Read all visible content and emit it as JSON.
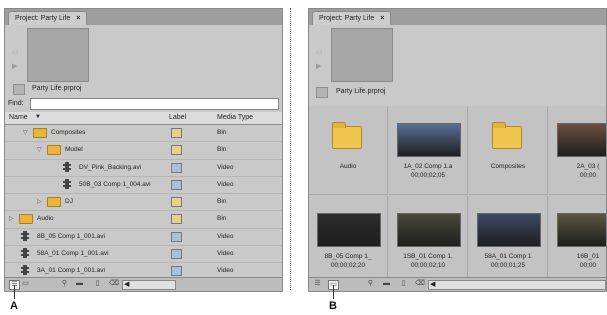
{
  "panelA": {
    "tab_title": "Project: Party Life",
    "tab_close": "×",
    "project_file": "Party Life.prproj",
    "find_label": "Find:",
    "find_value": "",
    "columns": {
      "name": "Name",
      "label": "Label",
      "media_type": "Media Type"
    },
    "rows": [
      {
        "name": "Composites",
        "type": "Bin",
        "kind": "folder",
        "indent": 1,
        "twisty": "open",
        "label_color": "#e8cf8a"
      },
      {
        "name": "Model",
        "type": "Bin",
        "kind": "folder",
        "indent": 2,
        "twisty": "open",
        "label_color": "#e8cf8a"
      },
      {
        "name": "DV_Pink_Backing.avi",
        "type": "Video",
        "kind": "clip",
        "indent": 3,
        "twisty": "",
        "label_color": "#a9c0d6"
      },
      {
        "name": "50B_03 Comp 1_004.avi",
        "type": "Video",
        "kind": "clip",
        "indent": 3,
        "twisty": "",
        "label_color": "#a9c0d6"
      },
      {
        "name": "DJ",
        "type": "Bin",
        "kind": "folder",
        "indent": 2,
        "twisty": "closed",
        "label_color": "#e8cf8a"
      },
      {
        "name": "Audio",
        "type": "Bin",
        "kind": "folder",
        "indent": 0,
        "twisty": "closed",
        "label_color": "#e8cf8a"
      },
      {
        "name": "8B_05 Comp 1_001.avi",
        "type": "Video",
        "kind": "clip",
        "indent": 0,
        "twisty": "",
        "label_color": "#a9c0d6"
      },
      {
        "name": "58A_01 Comp 1_001.avi",
        "type": "Video",
        "kind": "clip",
        "indent": 0,
        "twisty": "",
        "label_color": "#a9c0d6"
      },
      {
        "name": "3A_01 Comp 1_001.avi",
        "type": "Video",
        "kind": "clip",
        "indent": 0,
        "twisty": "",
        "label_color": "#a9c0d6"
      }
    ]
  },
  "panelB": {
    "tab_title": "Project: Party Life",
    "tab_close": "×",
    "project_file": "Party Life.prproj",
    "items": [
      {
        "name": "Audio",
        "duration": "",
        "kind": "folder"
      },
      {
        "name": "1A_02 Comp 1.a",
        "duration": "00;00;02;05",
        "kind": "clip",
        "thumb_color": "#5a6f96"
      },
      {
        "name": "Composites",
        "duration": "",
        "kind": "folder"
      },
      {
        "name": "2A_03 (",
        "duration": "00;00",
        "kind": "clip",
        "thumb_color": "#6b5040"
      },
      {
        "name": "8B_05 Comp 1_",
        "duration": "00;00;02;20",
        "kind": "clip",
        "thumb_color": "#2d2d2d"
      },
      {
        "name": "1SB_01 Comp 1.",
        "duration": "00;00;02;10",
        "kind": "clip",
        "thumb_color": "#4a4a3e"
      },
      {
        "name": "58A_01 Comp 1",
        "duration": "00;00;01;25",
        "kind": "clip",
        "thumb_color": "#3e4a66"
      },
      {
        "name": "16B_01",
        "duration": "00;00",
        "kind": "clip",
        "thumb_color": "#5c5640"
      }
    ]
  },
  "footer": {
    "list_view_icon": "list-view-icon",
    "icon_view_icon": "icon-view-icon",
    "automate_icon": "binoculars-icon",
    "new_bin_icon": "new-bin-icon",
    "new_item_icon": "new-item-icon",
    "clear_icon": "trash-icon",
    "scroll_left": "◀"
  },
  "callouts": {
    "a": "A",
    "b": "B"
  }
}
